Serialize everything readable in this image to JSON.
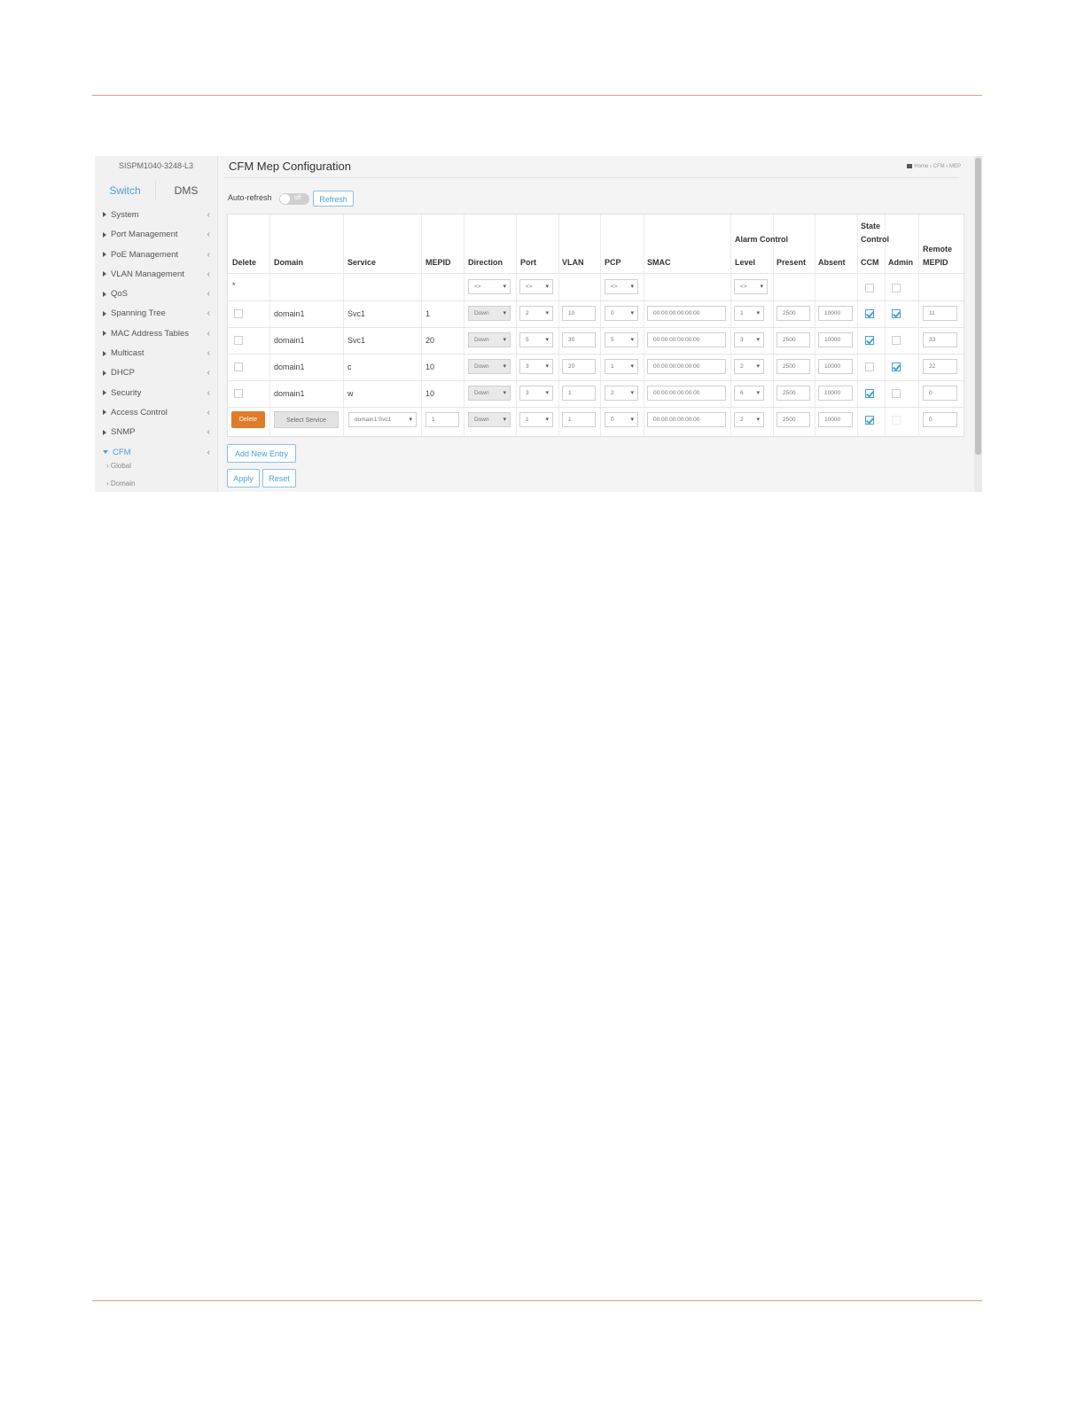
{
  "device_name": "SISPM1040-3248-L3",
  "tabs": [
    "Switch",
    "DMS"
  ],
  "nav": {
    "items": [
      "System",
      "Port Management",
      "PoE Management",
      "VLAN Management",
      "QoS",
      "Spanning Tree",
      "MAC Address Tables",
      "Multicast",
      "DHCP",
      "Security",
      "Access Control",
      "SNMP",
      "CFM"
    ],
    "active": "CFM",
    "sub_items": [
      "Global",
      "Domain"
    ]
  },
  "page_title": "CFM Mep Configuration",
  "breadcrumb": {
    "home": "Home",
    "section": "CFM",
    "page": "MEP"
  },
  "auto_refresh": {
    "label": "Auto-refresh",
    "state": "off",
    "refresh_label": "Refresh"
  },
  "table": {
    "group_headers": {
      "alarm": "Alarm Control",
      "state_l1": "State",
      "state_l2": "Control",
      "remote_l1": "Remote",
      "remote_l2": "MEPID"
    },
    "headers": [
      "Delete",
      "Domain",
      "Service",
      "MEPID",
      "Direction",
      "Port",
      "VLAN",
      "PCP",
      "SMAC",
      "Level",
      "Present",
      "Absent",
      "CCM",
      "Admin"
    ],
    "filter": {
      "marker": "*",
      "direction": "<>",
      "port": "<>",
      "pcp": "<>",
      "level": "<>"
    },
    "rows": [
      {
        "domain": "domain1",
        "service": "Svc1",
        "mepid": "1",
        "direction": "Down",
        "port": "2",
        "vlan": "10",
        "pcp": "0",
        "smac": "00:00:00:00:00:00",
        "level": "1",
        "present": "2500",
        "absent": "10000",
        "ccm": true,
        "admin": true,
        "remote": "11"
      },
      {
        "domain": "domain1",
        "service": "Svc1",
        "mepid": "20",
        "direction": "Down",
        "port": "5",
        "vlan": "30",
        "pcp": "5",
        "smac": "00:00:00:00:00:00",
        "level": "3",
        "present": "2500",
        "absent": "10000",
        "ccm": true,
        "admin": false,
        "remote": "33"
      },
      {
        "domain": "domain1",
        "service": "c",
        "mepid": "10",
        "direction": "Down",
        "port": "3",
        "vlan": "20",
        "pcp": "1",
        "smac": "00:00:00:00:00:00",
        "level": "2",
        "present": "2500",
        "absent": "10000",
        "ccm": false,
        "admin": true,
        "remote": "22"
      },
      {
        "domain": "domain1",
        "service": "w",
        "mepid": "10",
        "direction": "Down",
        "port": "3",
        "vlan": "1",
        "pcp": "2",
        "smac": "00:00:00:00:00:00",
        "level": "6",
        "present": "2500",
        "absent": "10000",
        "ccm": true,
        "admin": false,
        "remote": "0"
      }
    ],
    "new_row": {
      "delete_label": "Delete",
      "service_button": "Select Service",
      "service_select": "domain1:Svc1",
      "mepid": "1",
      "direction": "Down",
      "port": "1",
      "vlan": "1",
      "pcp": "0",
      "smac": "00:00:00:00:00:00",
      "level": "2",
      "present": "2500",
      "absent": "10000",
      "ccm": true,
      "admin": false,
      "remote": "0"
    }
  },
  "buttons": {
    "add_new": "Add New Entry",
    "apply": "Apply",
    "reset": "Reset"
  },
  "colors": {
    "accent": "#4a9fd8",
    "delete": "#e07b2a",
    "rule": "#d9a27a"
  }
}
